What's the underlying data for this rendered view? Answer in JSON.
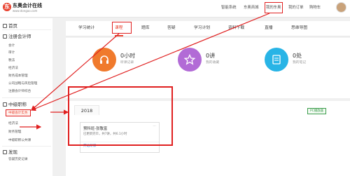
{
  "header": {
    "logo_mark": "东",
    "logo_text": "东奥会计在线",
    "logo_sub": "www.dongao.com",
    "nav": [
      "智能系统",
      "东奥商城",
      "我的东奥",
      "我的订单",
      "购物车"
    ]
  },
  "sidebar": {
    "home": "首页",
    "cpa_head": "注册会计师",
    "cpa_items": [
      "会计",
      "审计",
      "税法",
      "经济法",
      "财务成本管理",
      "公司战略与风险管理",
      "注册会计师综合"
    ],
    "mid_head": "中级职称",
    "mid_items": [
      "中级会计实务",
      "经济法",
      "财务管理",
      "中级职称公共课"
    ],
    "discover_head": "发现",
    "discover_items": [
      "答疑历史记录"
    ]
  },
  "tabs": [
    "学习统计",
    "课程",
    "题库",
    "答疑",
    "学习计划",
    "资料下载",
    "直播",
    "思维导图"
  ],
  "stats": [
    {
      "num": "0小时",
      "label": "听课记录",
      "color": "#f07a2c",
      "icon": "headphones-icon"
    },
    {
      "num": "0讲",
      "label": "我的收藏",
      "color": "#b26bd6",
      "icon": "star-icon"
    },
    {
      "num": "0处",
      "label": "我的笔记",
      "color": "#28b4e6",
      "icon": "note-icon"
    }
  ],
  "courses": {
    "year": "2018",
    "pc_button": "PC播放器",
    "card": {
      "title": "预科班-张敬富",
      "info": "已更新完毕，共7讲，共6.1小时",
      "more": "···",
      "link": "开始听课"
    }
  },
  "annotation_color": "#e02020"
}
